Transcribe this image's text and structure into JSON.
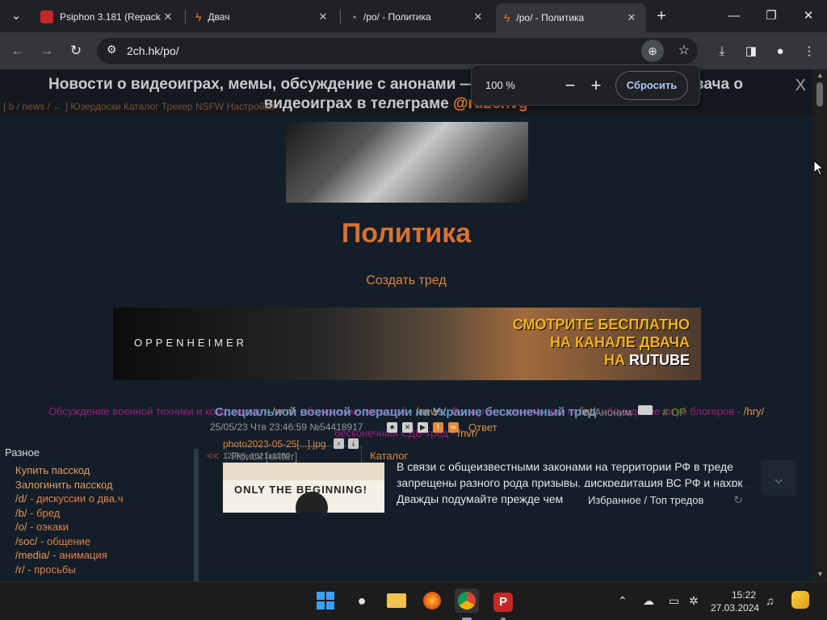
{
  "browser": {
    "tabs": [
      {
        "label": "Psiphon 3.181 (Repack"
      },
      {
        "label": "Двач"
      },
      {
        "label": "/po/ - Политика"
      },
      {
        "label": "/po/ - Политика"
      }
    ],
    "url": "2ch.hk/po/",
    "zoom": {
      "value": "100 %",
      "reset_label": "Сбросить"
    }
  },
  "announcement": {
    "text": "Новости о видеоиграх, мемы, обсуждение с анонами — подписывайтесь на канал Двача о видеоиграх в телеграме",
    "link": "@ru2chvg",
    "close": "X"
  },
  "topnav": "[ b / news / ← ] Юзердоски Каталог Трекер NSFW Настройки",
  "board": {
    "title": "Политика",
    "create_thread": "Создать тред"
  },
  "ad": {
    "left_text": "OPPENHEIMER",
    "line1": "СМОТРИТЕ БЕСПЛАТНО",
    "line2": "НА КАНАЛЕ ДВАЧА",
    "line3a": "НА ",
    "line3b": "RUTUBE"
  },
  "related_boards": [
    {
      "desc": "Обсуждение военной техники и конфликтов - ",
      "code": "/wm/"
    },
    {
      "desc": ", обсуждение новостей - ",
      "code": "/news/"
    },
    {
      "desc": ", Foreigners are welcome in ",
      "code": "/int/"
    },
    {
      "desc": ", обсуждение ютуб блогеров - ",
      "code": "/hry/"
    },
    {
      "desc": "бесконечный СДВ-тред - ",
      "code": "/nvr/"
    }
  ],
  "sidebar": {
    "heading": "Разное",
    "items": [
      {
        "code": "Купить пасскод",
        "desc": ""
      },
      {
        "code": "Залогинить пасскод",
        "desc": ""
      },
      {
        "code": "/d/",
        "desc": " - дискуссии о два.ч"
      },
      {
        "code": "/b/",
        "desc": " - бред"
      },
      {
        "code": "/o/",
        "desc": " - оэкаки"
      },
      {
        "code": "/soc/",
        "desc": " - общение"
      },
      {
        "code": "/media/",
        "desc": " - анимация"
      },
      {
        "code": "/r/",
        "desc": " - просьбы"
      }
    ]
  },
  "thread_controls": {
    "back": "<<",
    "search_placeholder": "Поиск [enter]",
    "catalog": "Каталог"
  },
  "post": {
    "title": "Специальной военной операции на Украине бесконечный тред",
    "author": "Аноним",
    "op_label": "# OP",
    "datetime": "25/05/23 Чтв 23:46:59",
    "number": "№54418917",
    "reply": "Ответ",
    "file_name": "photo2023-05-25[...].jpg",
    "file_info": "129Кб, 1021x1280",
    "thumb_text": "ONLY THE BEGINNING!",
    "body_line1": "В связи с общеизвестными законами на территории РФ в треде",
    "body_line2": "запрещены разного рода призывы, дискредитация ВС РФ и нахрк",
    "body_line3": "Дважды подумайте прежде чем"
  },
  "favorites": "Избранное / Топ тредов",
  "taskbar": {
    "time": "15:22",
    "date": "27.03.2024"
  }
}
